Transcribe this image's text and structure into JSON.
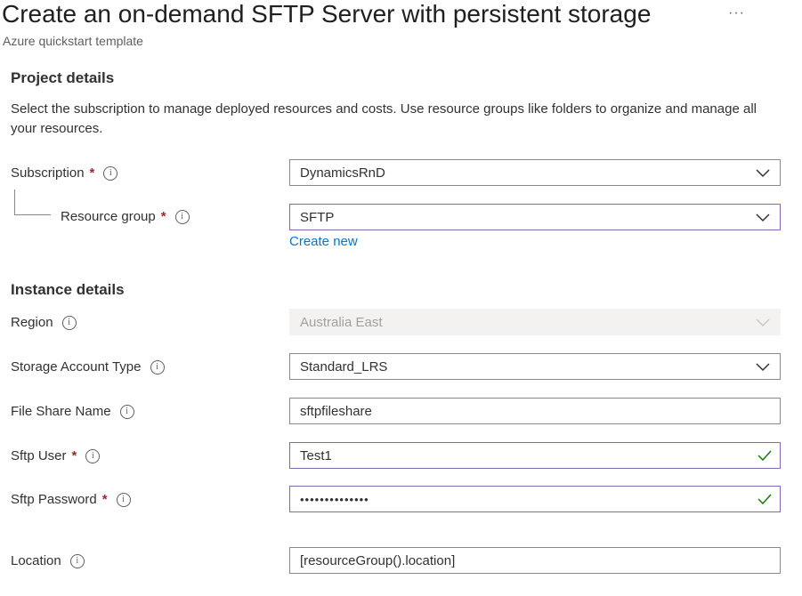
{
  "header": {
    "title": "Create an on-demand SFTP Server with persistent storage",
    "more_label": "···",
    "subtitle": "Azure quickstart template"
  },
  "project": {
    "heading": "Project details",
    "description": "Select the subscription to manage deployed resources and costs. Use resource groups like folders to organize and manage all your resources.",
    "subscription_label": "Subscription",
    "subscription_value": "DynamicsRnD",
    "resource_group_label": "Resource group",
    "resource_group_value": "SFTP",
    "create_new": "Create new"
  },
  "instance": {
    "heading": "Instance details",
    "region_label": "Region",
    "region_value": "Australia East",
    "storage_type_label": "Storage Account Type",
    "storage_type_value": "Standard_LRS",
    "file_share_label": "File Share Name",
    "file_share_value": "sftpfileshare",
    "sftp_user_label": "Sftp User",
    "sftp_user_value": "Test1",
    "sftp_password_label": "Sftp Password",
    "sftp_password_value": "••••••••••••••",
    "location_label": "Location",
    "location_value": "[resourceGroup().location]"
  },
  "symbols": {
    "required": "*",
    "info": "i"
  },
  "colors": {
    "accent_focus": "#8764b8",
    "link": "#0078d4",
    "required": "#a4262c",
    "valid_check": "#107c10"
  }
}
